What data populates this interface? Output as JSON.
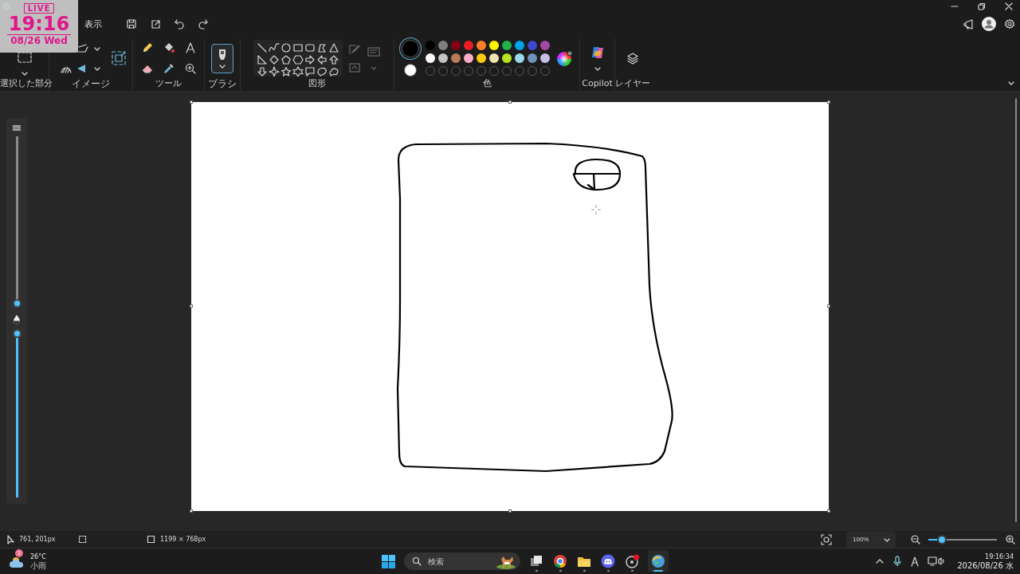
{
  "overlay_clock": {
    "badge": "LIVE",
    "time": "19:16",
    "date": "08/26 Wed"
  },
  "menu": [
    {
      "label": "表示"
    }
  ],
  "ribbon": {
    "groups": [
      {
        "kind": "selection",
        "label": "選択した部分"
      },
      {
        "kind": "image",
        "label": "イメージ"
      },
      {
        "kind": "tools",
        "label": "ツール"
      },
      {
        "kind": "brush",
        "label": "ブラシ"
      },
      {
        "kind": "shapes",
        "label": "図形"
      },
      {
        "kind": "colors",
        "label": "色"
      },
      {
        "kind": "copilot",
        "label": "Copilot"
      },
      {
        "kind": "layers",
        "label": "レイヤー"
      }
    ]
  },
  "colors": {
    "current": [
      {
        "color": "#000000",
        "selected": true
      },
      {
        "color": "#ffffff",
        "selected": false
      }
    ],
    "swatches": [
      {
        "color": "#000000"
      },
      {
        "color": "#7f7f7f"
      },
      {
        "color": "#880015"
      },
      {
        "color": "#ed1c24"
      },
      {
        "color": "#ff7f27"
      },
      {
        "color": "#fff200"
      },
      {
        "color": "#22b14c"
      },
      {
        "color": "#00a2e8"
      },
      {
        "color": "#3f48cc"
      },
      {
        "color": "#a349a4"
      },
      {
        "color": "#ffffff"
      },
      {
        "color": "#c3c3c3"
      },
      {
        "color": "#b97a57"
      },
      {
        "color": "#ffaec9"
      },
      {
        "color": "#ffc90e"
      },
      {
        "color": "#efe4b0"
      },
      {
        "color": "#b5e61d"
      },
      {
        "color": "#99d9ea"
      },
      {
        "color": "#7092be"
      },
      {
        "color": "#c8bfe7"
      }
    ]
  },
  "tool_sliders": [
    {
      "kind": "size",
      "level": 0.0
    },
    {
      "kind": "opacity",
      "level": 1.0
    }
  ],
  "status_bar": {
    "cursor": "761, 201px",
    "canvas_size": "1199 × 768px",
    "zoom": "100%",
    "zoom_slider": {
      "level": 0.15
    }
  },
  "taskbar": {
    "weather": {
      "badge": "1",
      "temperature": "26°C",
      "condition": "小雨"
    },
    "search": {
      "placeholder": "検索"
    },
    "apps": [
      {
        "kind": "task-view",
        "active": false
      },
      {
        "kind": "browser",
        "active": false
      },
      {
        "kind": "folder",
        "active": false
      },
      {
        "kind": "chat",
        "active": false
      },
      {
        "kind": "recorder",
        "active": false
      },
      {
        "kind": "paint",
        "active": true
      }
    ],
    "clock": {
      "time": "19:16:34",
      "date": "2026/08/26 水"
    }
  }
}
